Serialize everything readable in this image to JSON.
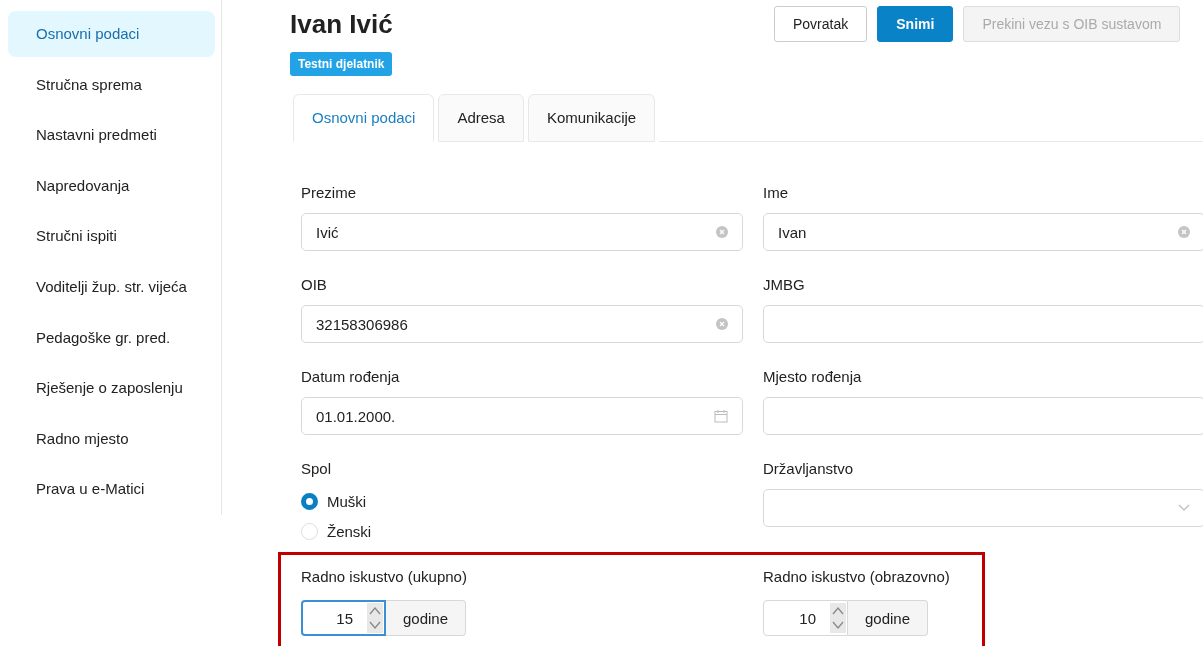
{
  "sidebar": {
    "items": [
      {
        "label": "Osnovni podaci",
        "selected": true
      },
      {
        "label": "Stručna sprema",
        "selected": false
      },
      {
        "label": "Nastavni predmeti",
        "selected": false
      },
      {
        "label": "Napredovanja",
        "selected": false
      },
      {
        "label": "Stručni ispiti",
        "selected": false
      },
      {
        "label": "Voditelji žup. str. vijeća",
        "selected": false
      },
      {
        "label": "Pedagoške gr. pred.",
        "selected": false
      },
      {
        "label": "Rješenje o zaposlenju",
        "selected": false
      },
      {
        "label": "Radno mjesto",
        "selected": false
      },
      {
        "label": "Prava u e-Matici",
        "selected": false
      }
    ]
  },
  "header": {
    "title": "Ivan Ivić",
    "badge": "Testni djelatnik",
    "buttons": [
      {
        "label": "Povratak",
        "kind": "default",
        "disabled": false
      },
      {
        "label": "Snimi",
        "kind": "primary",
        "disabled": false
      },
      {
        "label": "Prekini vezu s OIB sustavom",
        "kind": "default",
        "disabled": true
      }
    ]
  },
  "tabs": [
    {
      "label": "Osnovni podaci",
      "selected": true
    },
    {
      "label": "Adresa",
      "selected": false
    },
    {
      "label": "Komunikacije",
      "selected": false
    }
  ],
  "fields": [
    {
      "label": "Prezime",
      "kind": "text",
      "value": "Ivić"
    },
    {
      "label": "Ime",
      "kind": "text",
      "value": "Ivan"
    },
    {
      "label": "OIB",
      "kind": "text",
      "value": "32158306986"
    },
    {
      "label": "JMBG",
      "kind": "text"
    },
    {
      "label": "Datum rođenja",
      "kind": "date",
      "value": "01.01.2000."
    },
    {
      "label": "Mjesto rođenja",
      "kind": "text"
    },
    {
      "label": "Spol",
      "kind": "radio",
      "options": [
        {
          "label": "Muški",
          "selected": true
        },
        {
          "label": "Ženski",
          "selected": false
        }
      ]
    },
    {
      "label": "Državljanstvo",
      "kind": "select"
    }
  ],
  "experience": {
    "highlighted": true,
    "fields": [
      {
        "label": "Radno iskustvo (ukupno)",
        "value": "15",
        "unit": "godine",
        "focused": true
      },
      {
        "label": "Radno iskustvo (obrazovno)",
        "value": "10",
        "unit": "godine",
        "focused": false
      }
    ]
  }
}
